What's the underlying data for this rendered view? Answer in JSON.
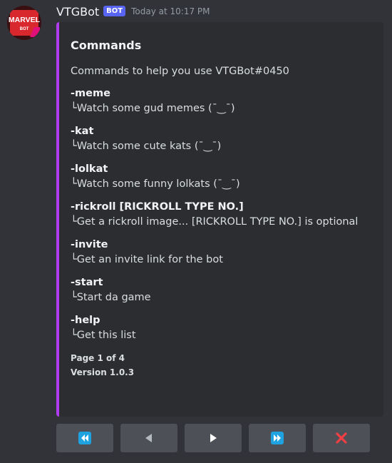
{
  "author": {
    "username": "VTGBot",
    "bot_tag": "BOT",
    "timestamp": "Today at 10:17 PM",
    "avatar_text_top": "MARVEL",
    "avatar_text_bottom": "BOT",
    "avatar_icon": "marvel-bot-logo"
  },
  "embed": {
    "accent_color": "#b03cf0",
    "title": "Commands",
    "description": "Commands to help you use VTGBot#0450",
    "fields": [
      {
        "name": "-meme",
        "value": "└Watch some gud memes (¯‿¯)"
      },
      {
        "name": "-kat",
        "value": "└Watch some cute kats (¯‿¯)"
      },
      {
        "name": "-lolkat",
        "value": "└Watch some funny lolkats (¯‿¯)"
      },
      {
        "name": "-rickroll [RICKROLL TYPE NO.]",
        "value": "└Get a rickroll image... [RICKROLL TYPE NO.] is optional"
      },
      {
        "name": "-invite",
        "value": "└Get an invite link for the bot"
      },
      {
        "name": "-start",
        "value": "└Start da game"
      },
      {
        "name": "-help",
        "value": "└Get this list"
      }
    ],
    "footer": {
      "page": "Page 1 of 4",
      "version": "Version 1.0.3"
    }
  },
  "buttons": [
    {
      "icon": "fast-rewind-icon",
      "color": "#1fa3e0"
    },
    {
      "icon": "previous-arrow-icon",
      "color": "#b5bac1"
    },
    {
      "icon": "next-arrow-icon",
      "color": "#ffffff"
    },
    {
      "icon": "fast-forward-icon",
      "color": "#1fa3e0"
    },
    {
      "icon": "close-x-icon",
      "color": "#f23f43"
    }
  ],
  "colors": {
    "background": "#313338",
    "embed_background": "#2b2d31",
    "button_background": "#4e5058",
    "bot_tag": "#5865f2"
  }
}
